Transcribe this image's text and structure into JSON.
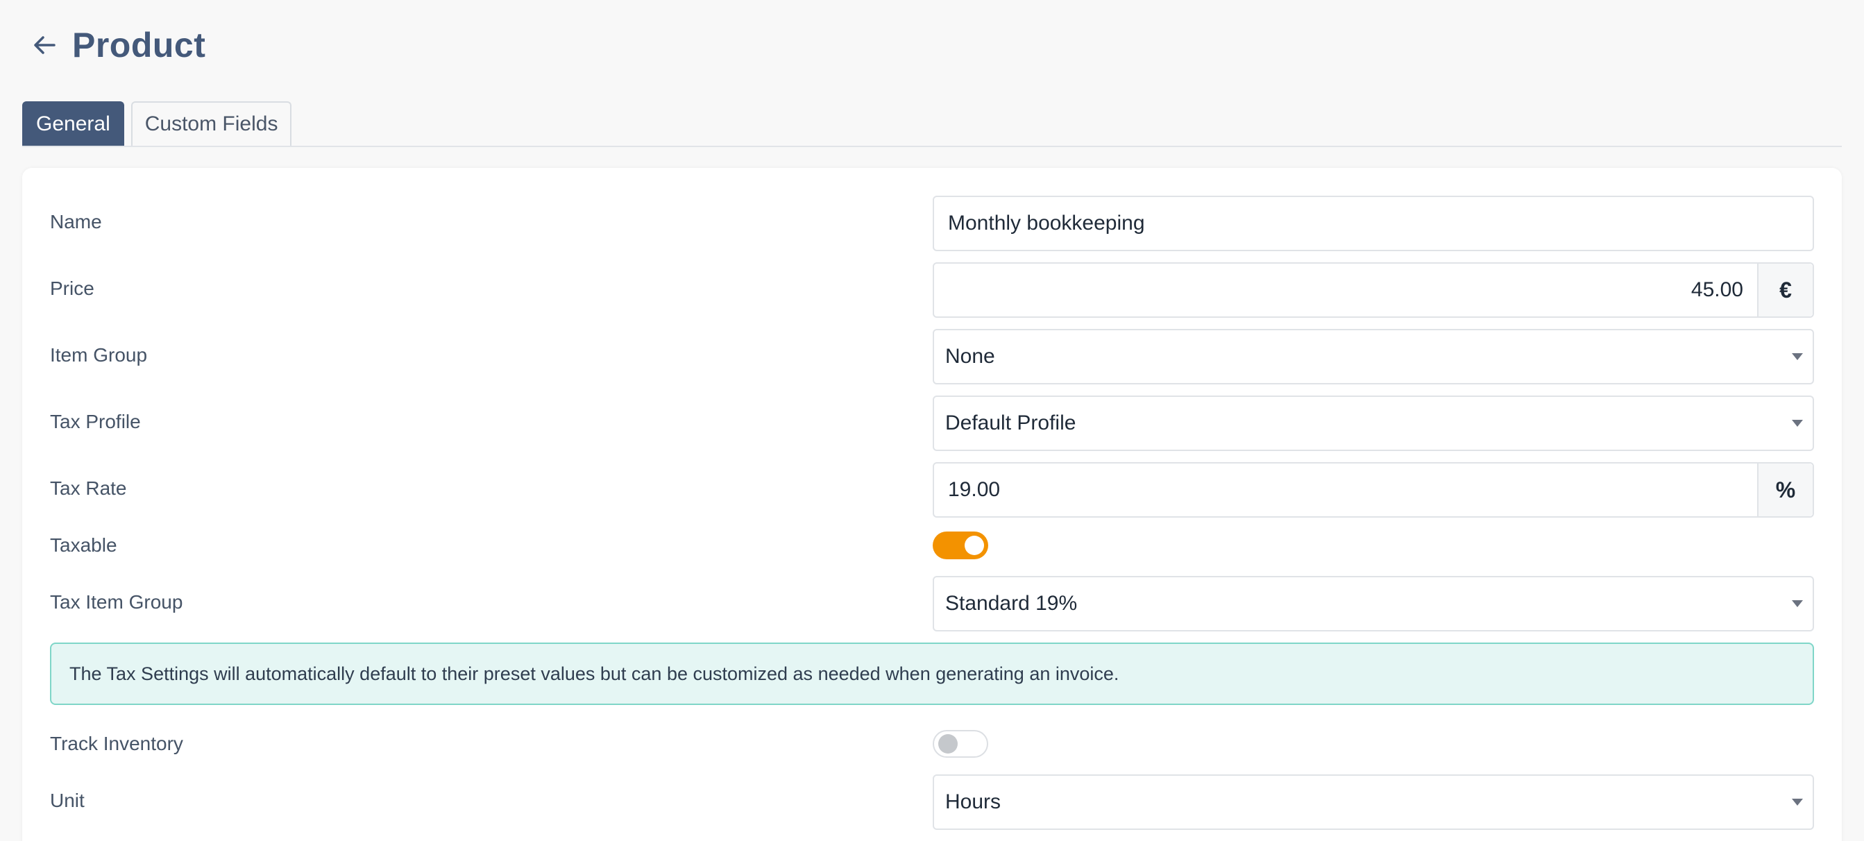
{
  "header": {
    "title": "Product",
    "back_icon": "arrow-left-icon"
  },
  "tabs": [
    {
      "label": "General",
      "active": true
    },
    {
      "label": "Custom Fields",
      "active": false
    }
  ],
  "form": {
    "name": {
      "label": "Name",
      "value": "Monthly bookkeeping"
    },
    "price": {
      "label": "Price",
      "value": "45.00",
      "addon": "€"
    },
    "item_group": {
      "label": "Item Group",
      "value": "None"
    },
    "tax_profile": {
      "label": "Tax Profile",
      "value": "Default Profile"
    },
    "tax_rate": {
      "label": "Tax Rate",
      "value": "19.00",
      "addon": "%"
    },
    "taxable": {
      "label": "Taxable",
      "on": true
    },
    "tax_item_group": {
      "label": "Tax Item Group",
      "value": "Standard 19%"
    },
    "notice": "The Tax Settings will automatically default to their preset values but can be customized as needed when generating an invoice.",
    "track_inventory": {
      "label": "Track Inventory",
      "on": false
    },
    "unit": {
      "label": "Unit",
      "value": "Hours"
    }
  },
  "colors": {
    "accent": "#44597a",
    "toggle_on": "#f39200",
    "notice_bg": "#e5f6f4",
    "notice_border": "#7fd6c8"
  }
}
